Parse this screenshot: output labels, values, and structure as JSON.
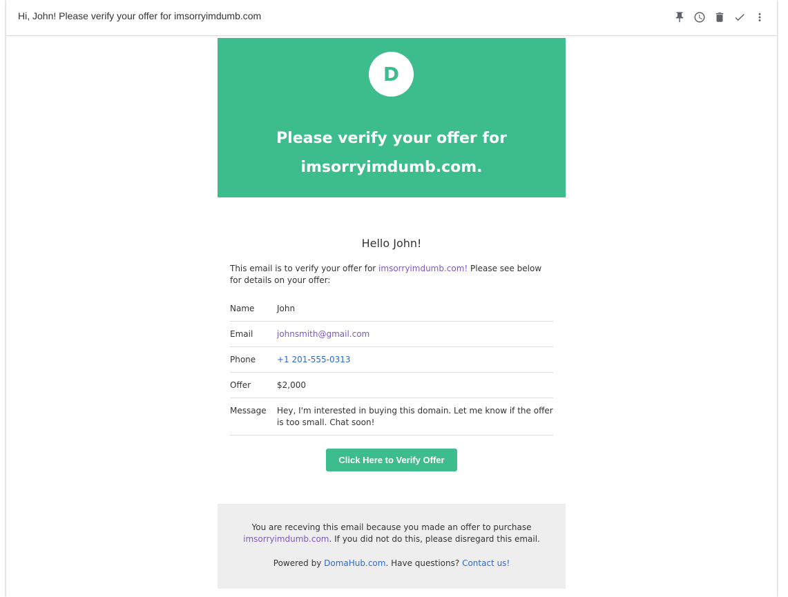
{
  "header": {
    "subject": "Hi, John! Please verify your offer for imsorryimdumb.com",
    "actions": [
      {
        "name": "pin-icon"
      },
      {
        "name": "snooze-clock-icon"
      },
      {
        "name": "trash-icon"
      },
      {
        "name": "checkmark-icon"
      },
      {
        "name": "more-vert-icon"
      }
    ]
  },
  "hero": {
    "logo_letter": "D",
    "title_line1": "Please verify your offer for",
    "title_line2": "imsorryimdumb.com."
  },
  "body": {
    "greeting": "Hello John!",
    "intro_prefix": "This email is to verify your offer for ",
    "intro_domain": "imsorryimdumb.com!",
    "intro_suffix": " Please see below for details on your offer:"
  },
  "details": {
    "name_label": "Name",
    "name_value": "John",
    "email_label": "Email",
    "email_value": "johnsmith@gmail.com",
    "phone_label": "Phone",
    "phone_value": "+1 201-555-0313",
    "offer_label": "Offer",
    "offer_value": "$2,000",
    "message_label": "Message",
    "message_value": "Hey, I'm interested in buying this domain. Let me know if the offer is too small. Chat soon!"
  },
  "cta": {
    "label": "Click Here to Verify Offer"
  },
  "footer": {
    "line1_prefix": "You are receving this email because you made an offer to purchase ",
    "line1_domain": "imsorryimdumb.com",
    "line1_suffix": ". If you did not do this, please disregard this email.",
    "powered_prefix": "Powered by ",
    "powered_link": "DomaHub.com",
    "powered_middle": ". Have questions? ",
    "contact_link": "Contact us!"
  },
  "colors": {
    "brand_green": "#3dbd8b",
    "link_purple": "#7e57c2",
    "link_blue": "#2a6ad2",
    "footer_bg": "#eeeeee"
  }
}
